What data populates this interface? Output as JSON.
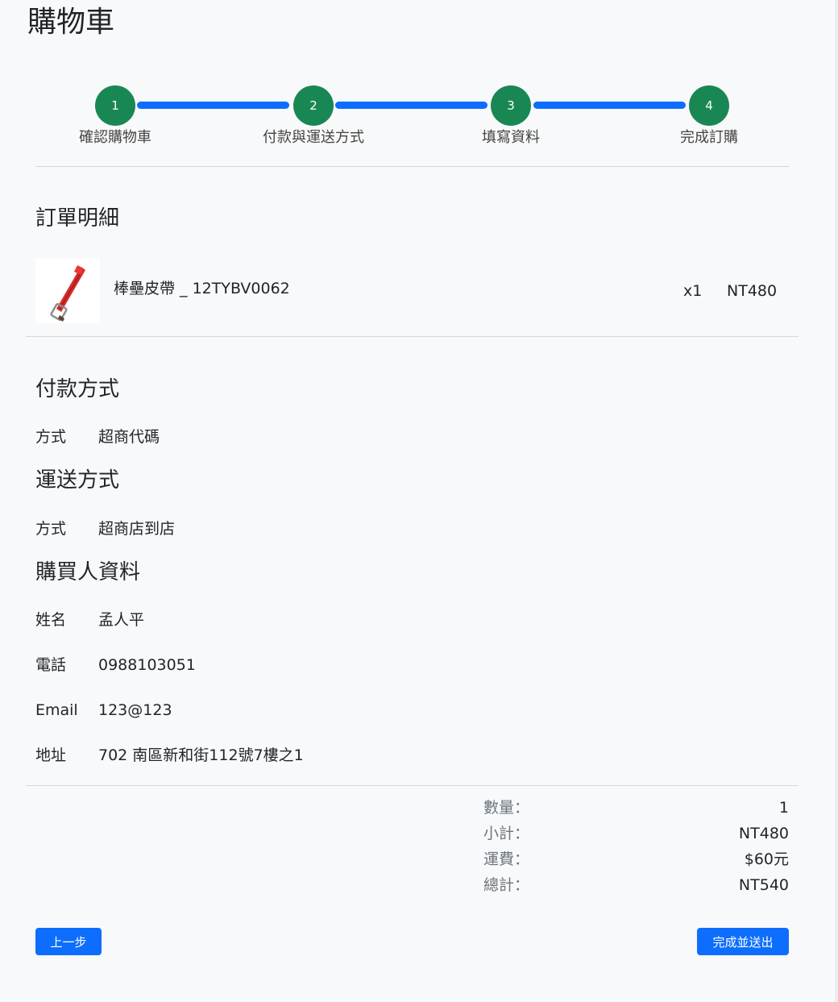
{
  "page_title": "購物車",
  "steps": [
    {
      "number": "1",
      "label": "確認購物車"
    },
    {
      "number": "2",
      "label": "付款與運送方式"
    },
    {
      "number": "3",
      "label": "填寫資料"
    },
    {
      "number": "4",
      "label": "完成訂購"
    }
  ],
  "order": {
    "title": "訂單明細",
    "items": [
      {
        "name": "棒壘皮帶 _ 12TYBV0062",
        "qty": "x1",
        "price": "NT480",
        "image": "red-leather-belt"
      }
    ]
  },
  "payment": {
    "title": "付款方式",
    "label": "方式",
    "value": "超商代碼"
  },
  "shipping": {
    "title": "運送方式",
    "label": "方式",
    "value": "超商店到店"
  },
  "buyer": {
    "title": "購買人資料",
    "fields": [
      {
        "label": "姓名",
        "value": "孟人平"
      },
      {
        "label": "電話",
        "value": "0988103051"
      },
      {
        "label": "Email",
        "value": "123@123"
      },
      {
        "label": "地址",
        "value": "702 南區新和街112號7樓之1"
      }
    ]
  },
  "summary": {
    "rows": [
      {
        "label": "數量：",
        "value": "1"
      },
      {
        "label": "小計：",
        "value": "NT480"
      },
      {
        "label": "運費：",
        "value": "$60元"
      },
      {
        "label": "總計：",
        "value": "NT540"
      }
    ]
  },
  "buttons": {
    "prev": "上一步",
    "submit": "完成並送出"
  },
  "colors": {
    "step_complete": "#198754",
    "progress_line": "#0d6efd",
    "primary_button": "#0d6efd",
    "background": "#f8f9fa"
  }
}
